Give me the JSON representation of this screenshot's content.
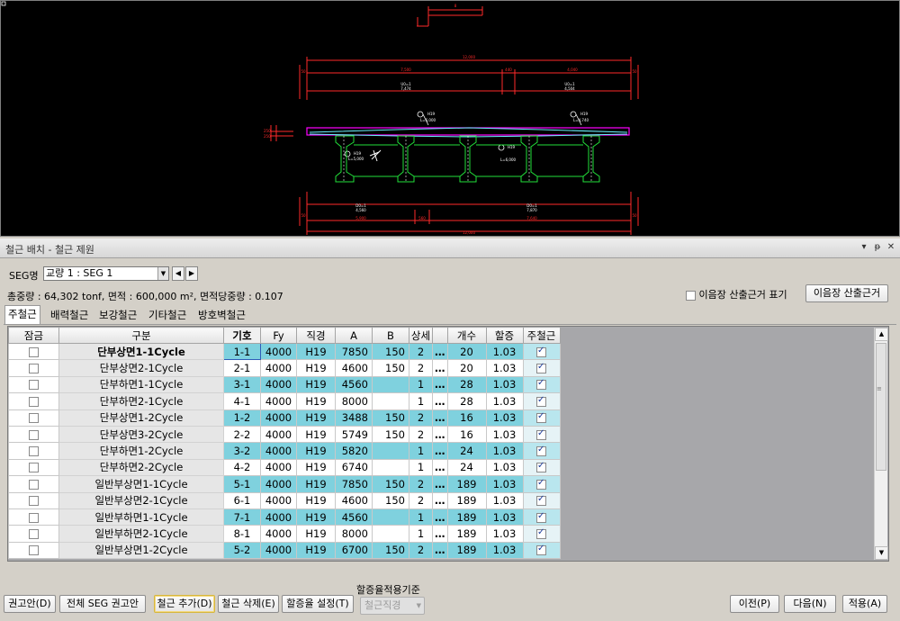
{
  "cad": {
    "dims": {
      "top_small": "8",
      "overall_top": "12,000",
      "left_seg": "7,500",
      "mid_seg": "440",
      "right_seg": "4,040",
      "u_left_a": "U0=1",
      "u_left_b": "7,474",
      "u_right_a": "U0=1",
      "u_right_b": "4,504",
      "bar_h19_a": "H19",
      "bar_l_a": "L=6,000",
      "bar_h19_b": "H19",
      "bar_l_b": "L=4,740",
      "bar_h19_c": "H19",
      "bar_l_c": "L=5,000",
      "bar_h19_d": "H19",
      "bar_l_d": "L=6,000",
      "bot_u_left_a": "D0=1",
      "bot_u_left_b": "4,560",
      "bot_u_right_a": "D0=1",
      "bot_u_right_b": "7,870",
      "bot_left": "5,900",
      "bot_mid": "560",
      "bot_right": "7,640",
      "overall_bottom": "12,000",
      "side_a": "250",
      "side_b": "250",
      "edge": "50"
    },
    "colors": {
      "dim": "#ff2a2a",
      "deck": "#ff00ff",
      "bar": "#6af0ff",
      "girder": "#22e03a",
      "tag": "#ffffff"
    }
  },
  "panel": {
    "title": "철근 배치 - 철근 제원",
    "pin_icon": "pin-icon",
    "close_icon": "close-icon"
  },
  "seg": {
    "label": "SEG명",
    "value": "교량 1 : SEG 1",
    "prev": "◀",
    "next": "▶"
  },
  "summary": "총중량 : 64,302 tonf, 면적 : 600,000 m², 면적당중량 : 0.107",
  "lap": {
    "checkbox_label": "이음장 산출근거 표기",
    "checked": false,
    "button": "이음장 산출근거"
  },
  "tabs": [
    "주철근",
    "배력철근",
    "보강철근",
    "기타철근",
    "방호벽철근"
  ],
  "grid": {
    "headers": [
      "잠금",
      "구분",
      "기호",
      "Fy",
      "직경",
      "A",
      "B",
      "상세",
      "",
      "개수",
      "할증",
      "주철근"
    ],
    "rows": [
      {
        "name": "단부상면1-1Cycle",
        "code": "1-1",
        "fy": "4000",
        "dia": "H19",
        "a": "7850",
        "b": "150",
        "detail": "2",
        "dots": "…",
        "count": "20",
        "extra": "1.03",
        "main": true,
        "teal": true
      },
      {
        "name": "단부상면2-1Cycle",
        "code": "2-1",
        "fy": "4000",
        "dia": "H19",
        "a": "4600",
        "b": "150",
        "detail": "2",
        "dots": "…",
        "count": "20",
        "extra": "1.03",
        "main": true,
        "teal": false
      },
      {
        "name": "단부하면1-1Cycle",
        "code": "3-1",
        "fy": "4000",
        "dia": "H19",
        "a": "4560",
        "b": "",
        "detail": "1",
        "dots": "…",
        "count": "28",
        "extra": "1.03",
        "main": true,
        "teal": true
      },
      {
        "name": "단부하면2-1Cycle",
        "code": "4-1",
        "fy": "4000",
        "dia": "H19",
        "a": "8000",
        "b": "",
        "detail": "1",
        "dots": "…",
        "count": "28",
        "extra": "1.03",
        "main": true,
        "teal": false
      },
      {
        "name": "단부상면1-2Cycle",
        "code": "1-2",
        "fy": "4000",
        "dia": "H19",
        "a": "3488",
        "b": "150",
        "detail": "2",
        "dots": "…",
        "count": "16",
        "extra": "1.03",
        "main": true,
        "teal": true
      },
      {
        "name": "단부상면3-2Cycle",
        "code": "2-2",
        "fy": "4000",
        "dia": "H19",
        "a": "5749",
        "b": "150",
        "detail": "2",
        "dots": "…",
        "count": "16",
        "extra": "1.03",
        "main": true,
        "teal": false
      },
      {
        "name": "단부하면1-2Cycle",
        "code": "3-2",
        "fy": "4000",
        "dia": "H19",
        "a": "5820",
        "b": "",
        "detail": "1",
        "dots": "…",
        "count": "24",
        "extra": "1.03",
        "main": true,
        "teal": true
      },
      {
        "name": "단부하면2-2Cycle",
        "code": "4-2",
        "fy": "4000",
        "dia": "H19",
        "a": "6740",
        "b": "",
        "detail": "1",
        "dots": "…",
        "count": "24",
        "extra": "1.03",
        "main": true,
        "teal": false
      },
      {
        "name": "일반부상면1-1Cycle",
        "code": "5-1",
        "fy": "4000",
        "dia": "H19",
        "a": "7850",
        "b": "150",
        "detail": "2",
        "dots": "…",
        "count": "189",
        "extra": "1.03",
        "main": true,
        "teal": true
      },
      {
        "name": "일반부상면2-1Cycle",
        "code": "6-1",
        "fy": "4000",
        "dia": "H19",
        "a": "4600",
        "b": "150",
        "detail": "2",
        "dots": "…",
        "count": "189",
        "extra": "1.03",
        "main": true,
        "teal": false
      },
      {
        "name": "일반부하면1-1Cycle",
        "code": "7-1",
        "fy": "4000",
        "dia": "H19",
        "a": "4560",
        "b": "",
        "detail": "1",
        "dots": "…",
        "count": "189",
        "extra": "1.03",
        "main": true,
        "teal": true
      },
      {
        "name": "일반부하면2-1Cycle",
        "code": "8-1",
        "fy": "4000",
        "dia": "H19",
        "a": "8000",
        "b": "",
        "detail": "1",
        "dots": "…",
        "count": "189",
        "extra": "1.03",
        "main": true,
        "teal": false
      },
      {
        "name": "일반부상면1-2Cycle",
        "code": "5-2",
        "fy": "4000",
        "dia": "H19",
        "a": "6700",
        "b": "150",
        "detail": "2",
        "dots": "…",
        "count": "189",
        "extra": "1.03",
        "main": true,
        "teal": true
      }
    ]
  },
  "footer": {
    "premium_label": "할증율적용기준",
    "premium_value": "철근직경",
    "btn_recommend": "권고안(D)",
    "btn_all_seg": "전체 SEG 권고안",
    "btn_add": "철근 추가(D)",
    "btn_delete": "철근 삭제(E)",
    "btn_premium": "할증율 설정(T)",
    "btn_prev": "이전(P)",
    "btn_next": "다음(N)",
    "btn_apply": "적용(A)"
  }
}
